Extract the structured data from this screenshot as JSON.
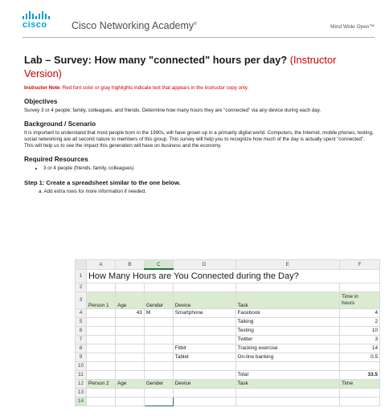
{
  "header": {
    "logo_text": "cisco",
    "brand": "Cisco Networking Academy",
    "brand_mark": "®",
    "tagline": "Mind Wide Open",
    "tagline_mark": "™"
  },
  "document": {
    "title": "Lab – Survey: How many \"connected\" hours per day?",
    "title_suffix": "(Instructor Version)",
    "note_label": "Instructor Note",
    "note_text": ": Red font color or gray highlights indicate text that appears in the instructor copy only.",
    "objectives_heading": "Objectives",
    "objectives_text": "Survey 3 or 4 people: family, colleagues, and friends.  Determine how many hours they are \"connected\" via any device during each day.",
    "background_heading": "Background / Scenario",
    "background_text": "It is important to understand that most people born in the 1990s, will have grown up in a primarily digital world. Computers, the Internet, mobile phones, texting, social networking are all second nature to members of this group. This survey will help you to recognize how much of the day is actually spent \"connected\". This will help us to see the impact this generation will have on business and the economy.",
    "resources_heading": "Required Resources",
    "resources_items": [
      "3 or 4 people (friends, family, colleagues)"
    ],
    "step1_heading": "Step 1:   Create a spreadsheet similar to the one below.",
    "step1_sub": "a.   Add extra rows for more information if needed."
  },
  "spreadsheet": {
    "columns": [
      "A",
      "B",
      "C",
      "D",
      "E",
      "F"
    ],
    "title": "How Many Hours are You Connected during the Day?",
    "rows": [
      {
        "n": "3",
        "green": true,
        "cells": [
          "Person 1",
          "Age",
          "Gender",
          "Device",
          "Task",
          "hours"
        ],
        "f_top": "Time in"
      },
      {
        "n": "4",
        "cells": [
          "",
          "43",
          "M",
          "Smartphone",
          "Facebook",
          "4"
        ]
      },
      {
        "n": "5",
        "cells": [
          "",
          "",
          "",
          "",
          "Talking",
          "2"
        ]
      },
      {
        "n": "6",
        "cells": [
          "",
          "",
          "",
          "",
          "Texting",
          "10"
        ]
      },
      {
        "n": "7",
        "cells": [
          "",
          "",
          "",
          "",
          "Twitter",
          "3"
        ]
      },
      {
        "n": "8",
        "cells": [
          "",
          "",
          "",
          "Fitbit",
          "Tracking exercise",
          "14"
        ]
      },
      {
        "n": "9",
        "cells": [
          "",
          "",
          "",
          "Tablet",
          "On-line banking",
          "0.5"
        ]
      },
      {
        "n": "10",
        "cells": [
          "",
          "",
          "",
          "",
          "",
          ""
        ]
      },
      {
        "n": "11",
        "cells": [
          "",
          "",
          "",
          "",
          "Total",
          "33.5"
        ]
      },
      {
        "n": "12",
        "green": true,
        "cells": [
          "Person 2",
          "Age",
          "Gender",
          "Device",
          "Task",
          "Time"
        ]
      },
      {
        "n": "13",
        "cells": [
          "",
          "",
          "",
          "",
          "",
          ""
        ]
      },
      {
        "n": "14",
        "cells": [
          "",
          "",
          "",
          "",
          "",
          ""
        ]
      }
    ]
  }
}
